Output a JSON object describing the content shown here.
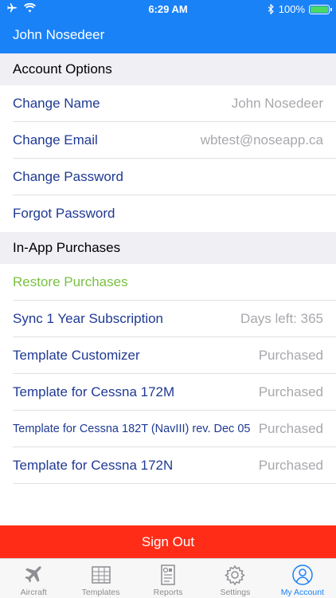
{
  "status": {
    "time": "6:29 AM",
    "battery": "100%",
    "battery_level": 1.0
  },
  "header": {
    "title": "John Nosedeer"
  },
  "account_options": {
    "header": "Account Options",
    "change_name": {
      "label": "Change Name",
      "value": "John Nosedeer"
    },
    "change_email": {
      "label": "Change Email",
      "value": "wbtest@noseapp.ca"
    },
    "change_password": {
      "label": "Change Password"
    },
    "forgot_password": {
      "label": "Forgot Password"
    }
  },
  "in_app_purchases": {
    "header": "In-App Purchases",
    "restore": {
      "label": "Restore Purchases"
    },
    "items": [
      {
        "label": "Sync 1 Year Subscription",
        "value": "Days left:  365"
      },
      {
        "label": "Template Customizer",
        "value": "Purchased"
      },
      {
        "label": "Template for Cessna 172M",
        "value": "Purchased"
      },
      {
        "label": "Template for Cessna 182T (NavIII) rev. Dec 05",
        "value": "Purchased"
      },
      {
        "label": "Template for Cessna 172N",
        "value": "Purchased"
      }
    ]
  },
  "sign_out": {
    "label": "Sign Out"
  },
  "tabs": [
    {
      "label": "Aircraft",
      "icon": "airplane-icon"
    },
    {
      "label": "Templates",
      "icon": "templates-icon"
    },
    {
      "label": "Reports",
      "icon": "reports-icon"
    },
    {
      "label": "Settings",
      "icon": "gear-icon"
    },
    {
      "label": "My Account",
      "icon": "person-icon",
      "active": true
    }
  ],
  "colors": {
    "brand_blue": "#1a82f7",
    "link_text": "#1f3a93",
    "restore_green": "#7ac143",
    "sign_out_red": "#ff2d18"
  }
}
